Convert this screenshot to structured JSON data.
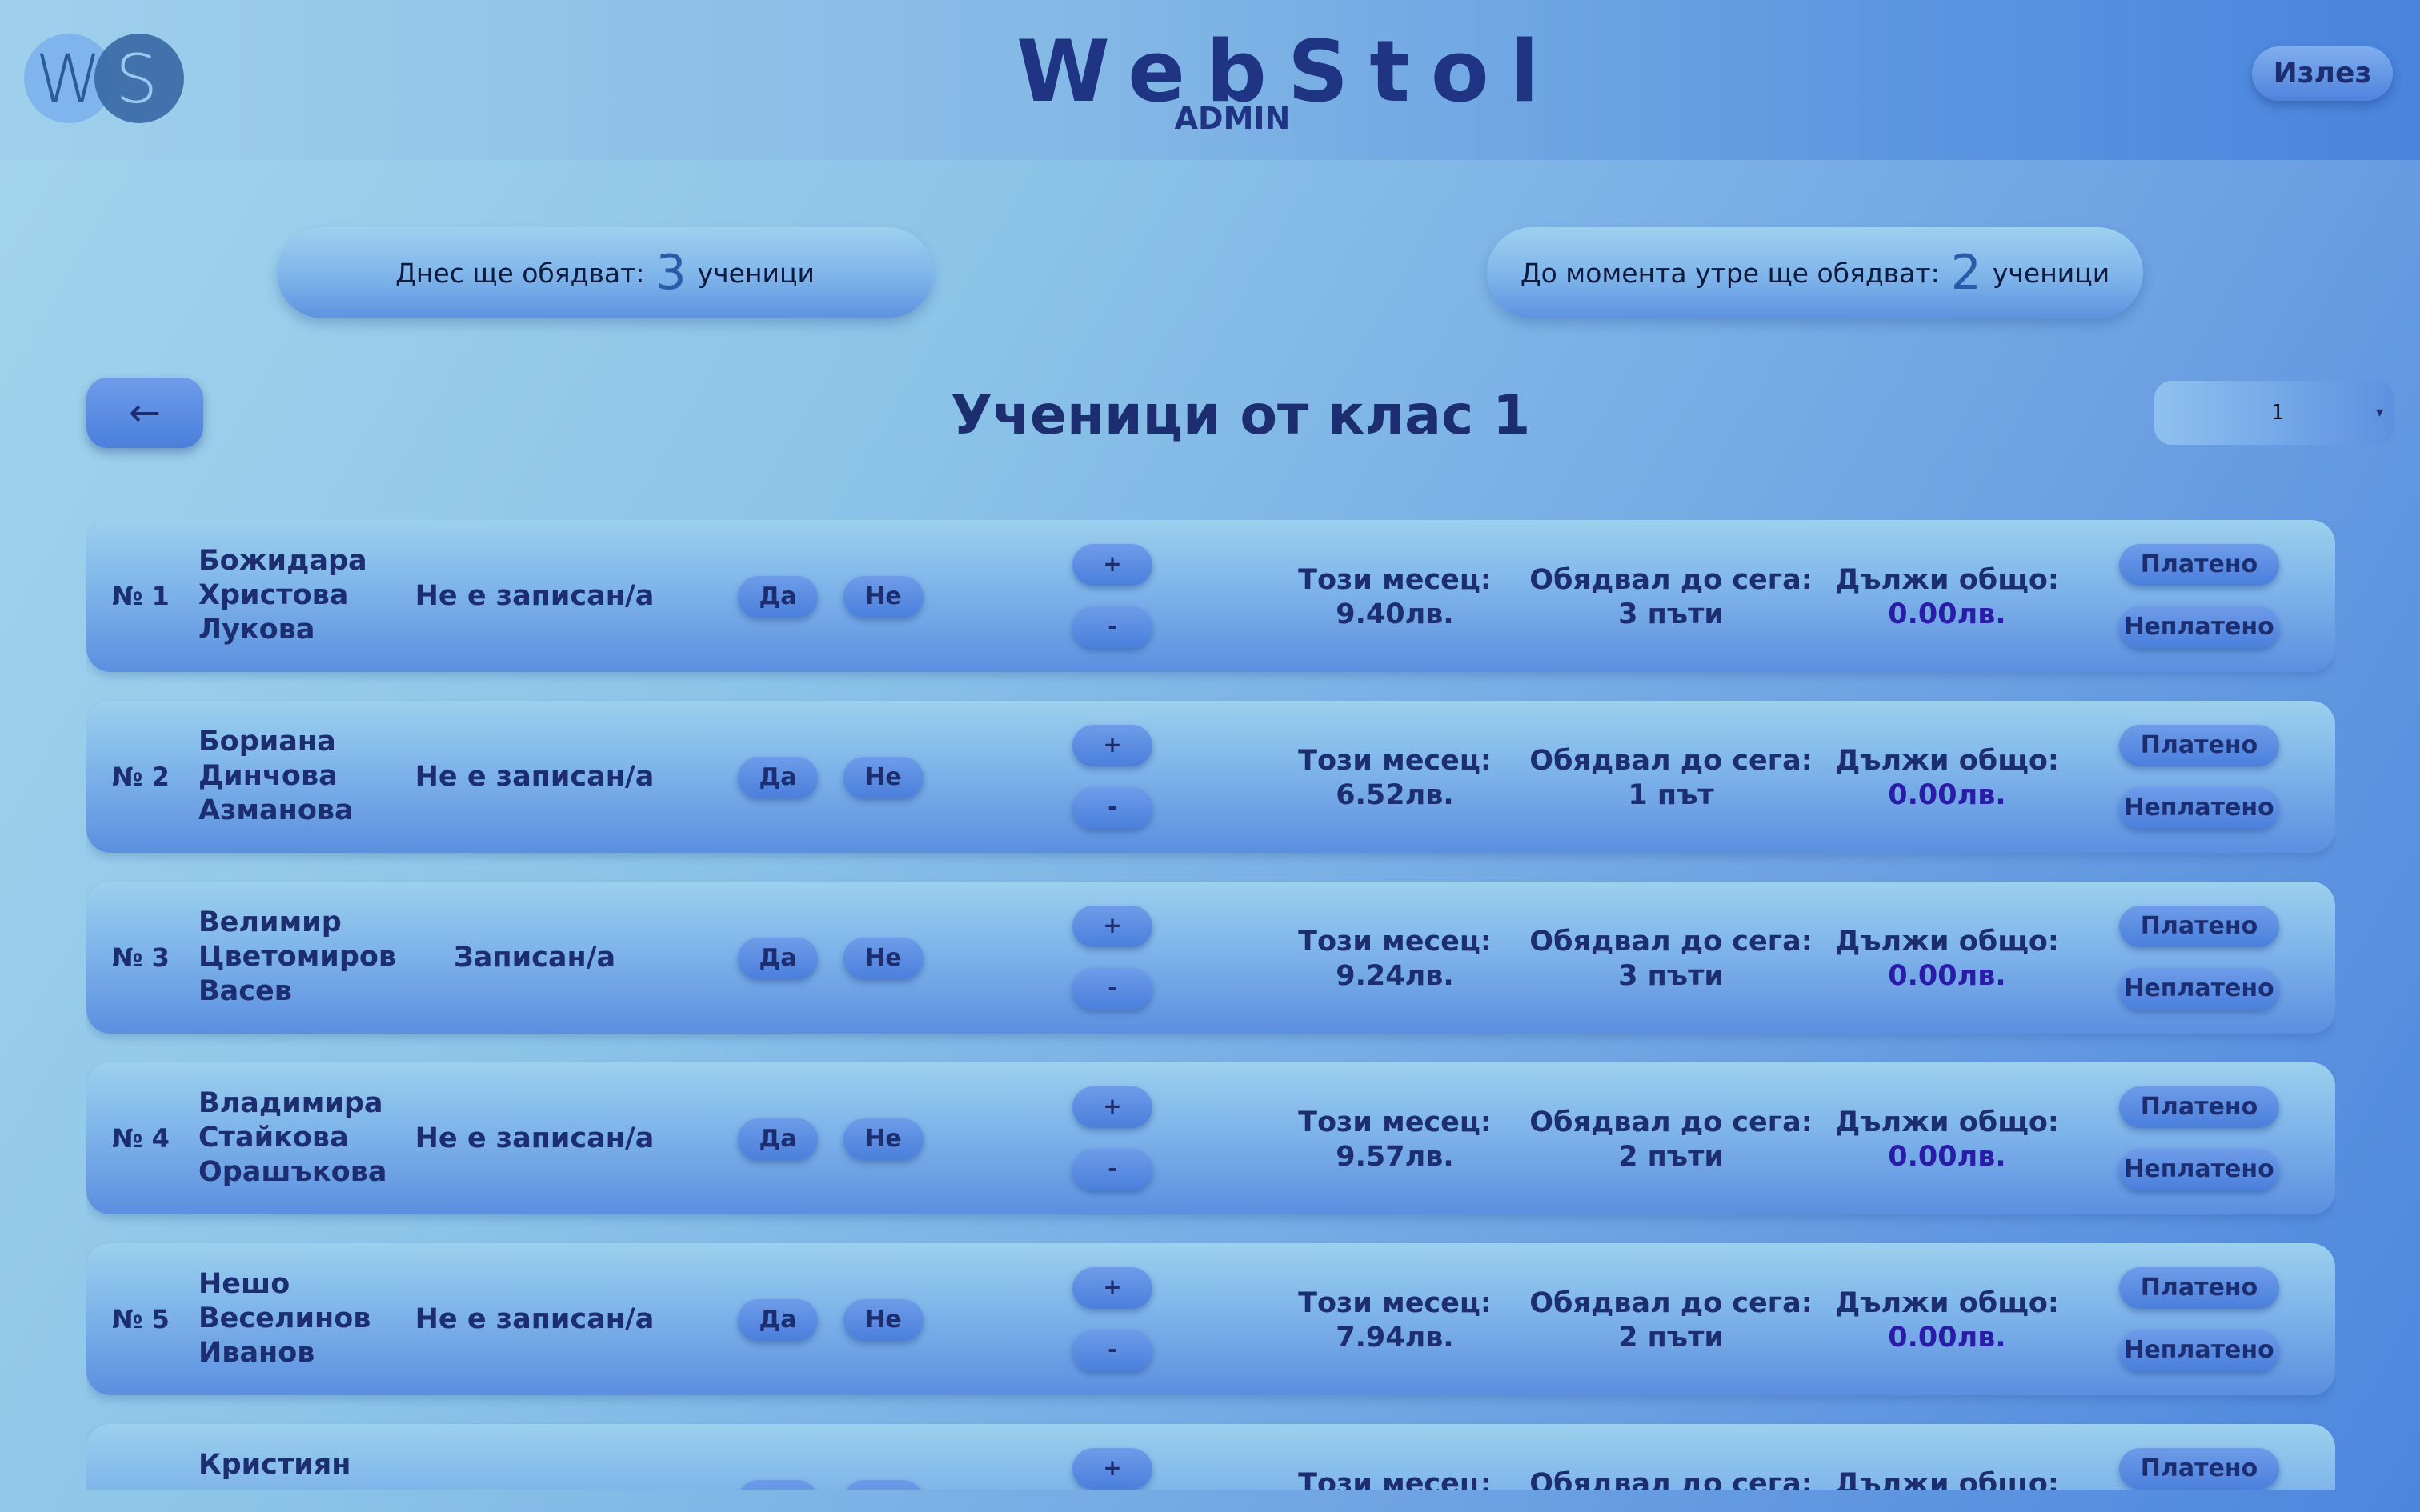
{
  "header": {
    "logo_letter_1": "W",
    "logo_letter_2": "S",
    "brand": "WebStol",
    "subtitle": "ADMIN",
    "logout_label": "Излез"
  },
  "summary": {
    "today_prefix": "Днес ще обядват:",
    "today_count": "3",
    "today_suffix": "ученици",
    "tomorrow_prefix": "До момента утре ще обядват:",
    "tomorrow_count": "2",
    "tomorrow_suffix": "ученици"
  },
  "class_view": {
    "back_icon": "←",
    "title": "Ученици от клас 1",
    "class_select_value": "1",
    "class_select_caret": "▾"
  },
  "labels": {
    "yes": "Да",
    "no": "Не",
    "plus": "+",
    "minus": "-",
    "this_month": "Този месец:",
    "ate_so_far": "Обядвал до сега:",
    "owes_total": "Дължи общо:",
    "paid": "Платено",
    "unpaid": "Неплатено"
  },
  "students": [
    {
      "num": "№ 1",
      "name1": "Божидара",
      "name2": "Христова",
      "name3": "Лукова",
      "status": "Не е записан/а",
      "month": "9.40лв.",
      "count": "3 пъти",
      "owes": "0.00лв."
    },
    {
      "num": "№ 2",
      "name1": "Бориана",
      "name2": "Динчова",
      "name3": "Азманова",
      "status": "Не е записан/а",
      "month": "6.52лв.",
      "count": "1 път",
      "owes": "0.00лв."
    },
    {
      "num": "№ 3",
      "name1": "Велимир",
      "name2": "Цветомиров",
      "name3": "Васев",
      "status": "Записан/а",
      "month": "9.24лв.",
      "count": "3 пъти",
      "owes": "0.00лв."
    },
    {
      "num": "№ 4",
      "name1": "Владимира",
      "name2": "Стайкова",
      "name3": "Орашъкова",
      "status": "Не е записан/а",
      "month": "9.57лв.",
      "count": "2 пъти",
      "owes": "0.00лв."
    },
    {
      "num": "№ 5",
      "name1": "Нешо",
      "name2": "Веселинов",
      "name3": "Иванов",
      "status": "Не е записан/а",
      "month": "7.94лв.",
      "count": "2 пъти",
      "owes": "0.00лв."
    },
    {
      "num": "",
      "name1": "Кристиян",
      "name2": "",
      "name3": "",
      "status": "",
      "month": "",
      "count": "",
      "owes": ""
    }
  ]
}
